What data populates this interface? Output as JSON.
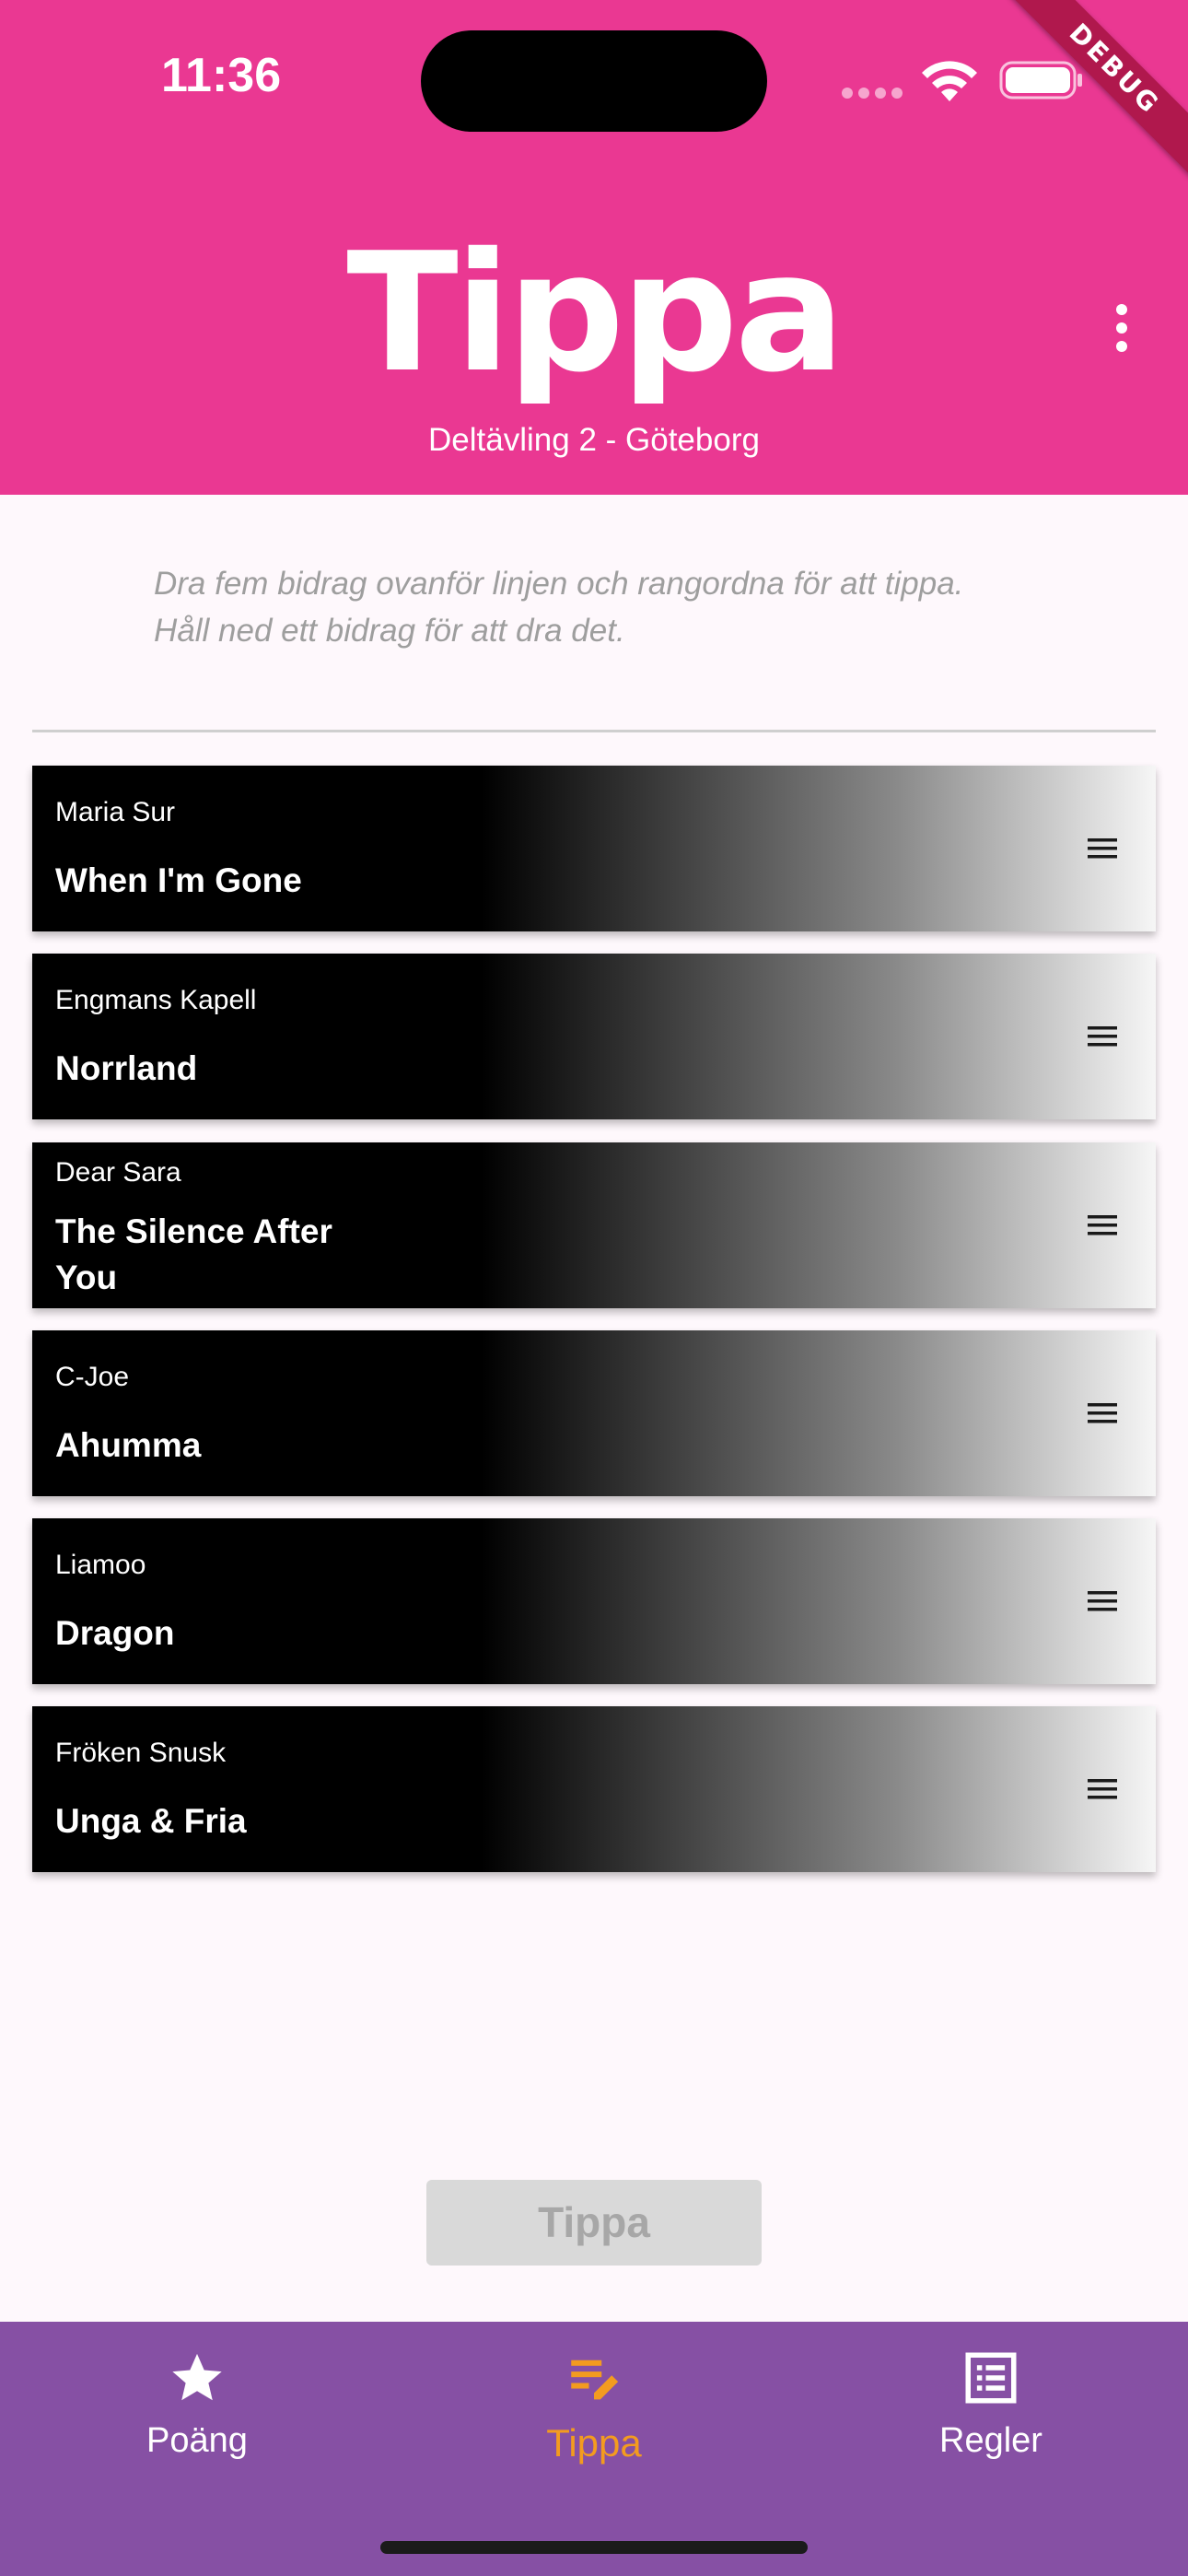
{
  "status_bar": {
    "time": "11:36"
  },
  "debug_banner": "DEBUG",
  "header": {
    "title": "Tippa",
    "subtitle": "Deltävling 2 - Göteborg",
    "background": "#ea3892"
  },
  "instructions": {
    "line1": "Dra fem bidrag ovanför linjen och rangordna för att tippa.",
    "line2": "Håll ned ett bidrag för att dra det."
  },
  "entries": [
    {
      "artist": "Maria Sur",
      "song": "When I'm Gone"
    },
    {
      "artist": "Engmans Kapell",
      "song": "Norrland"
    },
    {
      "artist": "Dear Sara",
      "song": "The Silence After You"
    },
    {
      "artist": "C-Joe",
      "song": "Ahumma"
    },
    {
      "artist": "Liamoo",
      "song": "Dragon"
    },
    {
      "artist": "Fröken Snusk",
      "song": "Unga & Fria"
    }
  ],
  "submit_button": {
    "label": "Tippa",
    "enabled": false
  },
  "bottom_nav": {
    "background": "#8650a4",
    "active_color": "#f39b1f",
    "items": [
      {
        "label": "Poäng",
        "icon": "star-icon",
        "active": false
      },
      {
        "label": "Tippa",
        "icon": "edit-list-icon",
        "active": true
      },
      {
        "label": "Regler",
        "icon": "list-icon",
        "active": false
      }
    ]
  }
}
